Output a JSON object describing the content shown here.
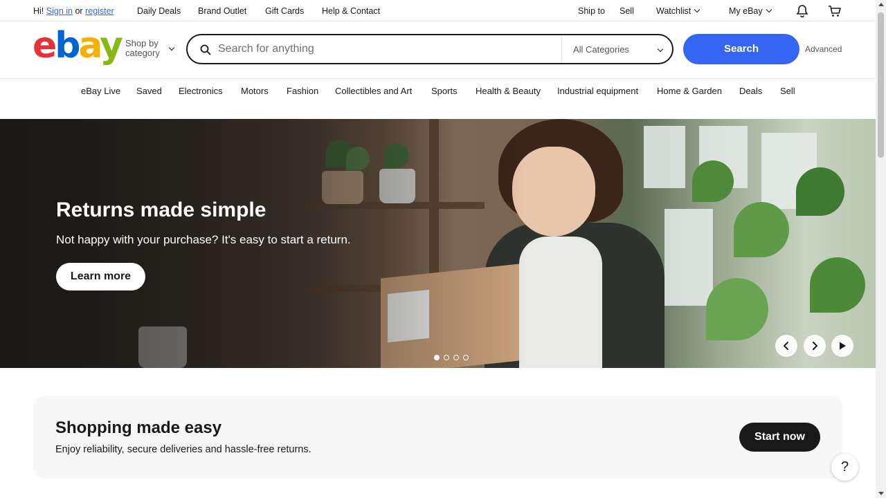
{
  "topbar": {
    "greeting": "Hi!",
    "sign_in": "Sign in",
    "or": "or",
    "register": "register",
    "links": [
      "Daily Deals",
      "Brand Outlet",
      "Gift Cards",
      "Help & Contact"
    ],
    "ship_to": "Ship to",
    "sell": "Sell",
    "watchlist": "Watchlist",
    "my_ebay": "My eBay",
    "icons": [
      "bell-icon",
      "cart-icon"
    ]
  },
  "header": {
    "logo": {
      "e": "e",
      "b": "b",
      "a": "a",
      "y": "y"
    },
    "shop_by_line1": "Shop by",
    "shop_by_line2": "category",
    "search_placeholder": "Search for anything",
    "category_selected": "All Categories",
    "search_button": "Search",
    "advanced": "Advanced"
  },
  "category_nav": [
    "eBay Live",
    "Saved",
    "Electronics",
    "Motors",
    "Fashion",
    "Collectibles and Art",
    "Sports",
    "Health & Beauty",
    "Industrial equipment",
    "Home & Garden",
    "Deals",
    "Sell"
  ],
  "hero": {
    "title": "Returns made simple",
    "subtitle": "Not happy with your purchase? It's easy to start a return.",
    "button": "Learn more",
    "slides_total": 4,
    "active_slide": 1
  },
  "promo": {
    "title": "Shopping made easy",
    "subtitle": "Enjoy reliability, secure deliveries and hassle-free returns.",
    "button": "Start now"
  },
  "help_button": "?",
  "colors": {
    "accent": "#3665f3",
    "logo_e": "#e53238",
    "logo_b": "#0064d2",
    "logo_a": "#f5af02",
    "logo_y": "#86b817"
  }
}
